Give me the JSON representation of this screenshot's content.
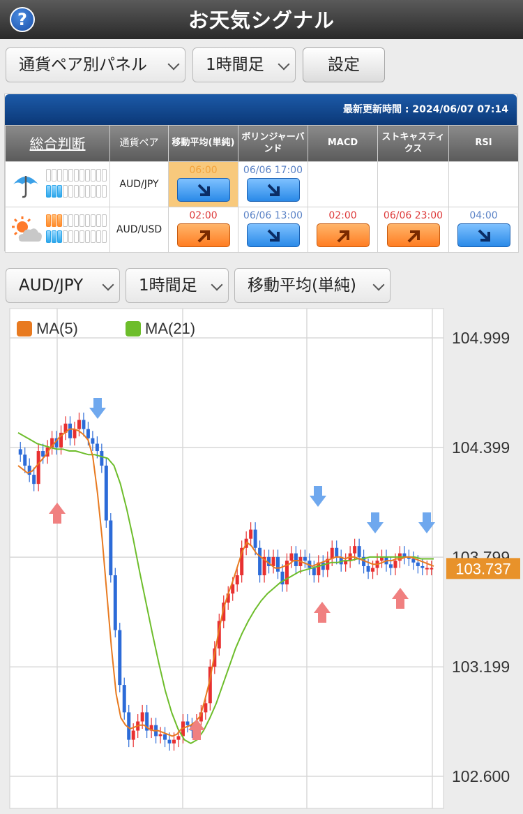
{
  "header": {
    "title": "お天気シグナル",
    "help_label": "?"
  },
  "controls": {
    "panel_select": "通貨ペア別パネル",
    "timeframe_select": "1時間足",
    "settings_button": "設定"
  },
  "panel": {
    "updated_text": "最新更新時間 : 2024/06/07 07:14",
    "headers": {
      "overall": "総合判断",
      "pair": "通貨ペア",
      "ma": "移動平均(単純)",
      "bollinger": "ボリンジャーバンド",
      "macd": "MACD",
      "stoch": "ストキャスティクス",
      "rsi": "RSI"
    },
    "rows": [
      {
        "pair": "AUD/JPY",
        "weather": "rain",
        "gauge_top": 0,
        "gauge_bottom": 3,
        "ma": {
          "time": "06:00",
          "dir": "down"
        },
        "bollinger": {
          "time": "06/06 17:00",
          "dir": "down"
        }
      },
      {
        "pair": "AUD/USD",
        "weather": "sun-cloud",
        "gauge_top": 3,
        "gauge_bottom": 3,
        "ma": {
          "time": "02:00",
          "dir": "up"
        },
        "bollinger": {
          "time": "06/06 13:00",
          "dir": "down"
        },
        "macd": {
          "time": "02:00",
          "dir": "up"
        },
        "stoch": {
          "time": "06/06 23:00",
          "dir": "up"
        },
        "rsi": {
          "time": "04:00",
          "dir": "down"
        }
      }
    ]
  },
  "chart_controls": {
    "pair_select": "AUD/JPY",
    "timeframe_select": "1時間足",
    "indicator_select": "移動平均(単純)"
  },
  "colors": {
    "up_candle": "#e83030",
    "down_candle": "#2c6bd8",
    "ma5": "#e87a20",
    "ma21": "#6dbd2b",
    "price_tag": "#e8922a",
    "signal_up": "#f08080",
    "signal_down": "#6fa8ee"
  },
  "chart_data": {
    "type": "line",
    "legend": [
      {
        "name": "MA(5)",
        "color": "#e87a20"
      },
      {
        "name": "MA(21)",
        "color": "#6dbd2b"
      }
    ],
    "y_ticks": [
      "104.999",
      "104.399",
      "103.799",
      "103.199",
      "102.600"
    ],
    "ylim": [
      102.6,
      104.999
    ],
    "current_price": "103.737",
    "close": [
      104.36,
      104.3,
      104.25,
      104.2,
      104.38,
      104.35,
      104.4,
      104.45,
      104.4,
      104.48,
      104.53,
      104.45,
      104.5,
      104.55,
      104.5,
      104.45,
      104.42,
      104.38,
      104.3,
      104.0,
      103.7,
      103.4,
      103.1,
      102.95,
      102.8,
      102.85,
      102.9,
      102.95,
      102.85,
      102.88,
      102.82,
      102.83,
      102.8,
      102.78,
      102.8,
      102.82,
      102.9,
      102.88,
      102.85,
      102.9,
      102.95,
      103.0,
      103.2,
      103.3,
      103.45,
      103.55,
      103.6,
      103.65,
      103.7,
      103.85,
      103.9,
      103.95,
      103.85,
      103.7,
      103.8,
      103.75,
      103.8,
      103.72,
      103.65,
      103.78,
      103.82,
      103.75,
      103.8,
      103.78,
      103.74,
      103.7,
      103.77,
      103.73,
      103.79,
      103.85,
      103.8,
      103.76,
      103.78,
      103.82,
      103.86,
      103.8,
      103.75,
      103.72,
      103.74,
      103.78,
      103.8,
      103.76,
      103.74,
      103.78,
      103.82,
      103.8,
      103.79,
      103.77,
      103.75,
      103.74,
      103.74,
      103.74
    ],
    "ma5": [
      104.3,
      104.28,
      104.26,
      104.27,
      104.3,
      104.33,
      104.36,
      104.4,
      104.43,
      104.46,
      104.48,
      104.5,
      104.5,
      104.49,
      104.47,
      104.44,
      104.35,
      104.15,
      103.9,
      103.6,
      103.3,
      103.05,
      102.92,
      102.88,
      102.86,
      102.87,
      102.88,
      102.88,
      102.86,
      102.85,
      102.85,
      102.84,
      102.83,
      102.82,
      102.83,
      102.86,
      102.87,
      102.88,
      102.9,
      102.93,
      103.02,
      103.12,
      103.26,
      103.4,
      103.52,
      103.6,
      103.67,
      103.75,
      103.83,
      103.88,
      103.86,
      103.82,
      103.8,
      103.78,
      103.76,
      103.74,
      103.74,
      103.75,
      103.76,
      103.78,
      103.78,
      103.77,
      103.76,
      103.75,
      103.76,
      103.77,
      103.78,
      103.79,
      103.8,
      103.8,
      103.79,
      103.8,
      103.8,
      103.79,
      103.78,
      103.77,
      103.76,
      103.76,
      103.77,
      103.78,
      103.78,
      103.79,
      103.79,
      103.8,
      103.8,
      103.79,
      103.78,
      103.77,
      103.76,
      103.75
    ],
    "ma21": [
      104.48,
      104.46,
      104.44,
      104.42,
      104.41,
      104.4,
      104.39,
      104.39,
      104.38,
      104.38,
      104.37,
      104.36,
      104.36,
      104.35,
      104.34,
      104.3,
      104.2,
      104.06,
      103.9,
      103.72,
      103.55,
      103.38,
      103.22,
      103.07,
      102.95,
      102.86,
      102.8,
      102.78,
      102.8,
      102.85,
      102.92,
      103.0,
      103.1,
      103.2,
      103.3,
      103.38,
      103.45,
      103.51,
      103.56,
      103.6,
      103.63,
      103.66,
      103.68,
      103.7,
      103.72,
      103.73,
      103.74,
      103.75,
      103.76,
      103.77,
      103.77,
      103.78,
      103.78,
      103.79,
      103.79,
      103.8,
      103.8,
      103.8,
      103.8,
      103.8,
      103.8,
      103.8,
      103.8,
      103.79,
      103.79,
      103.79
    ]
  }
}
